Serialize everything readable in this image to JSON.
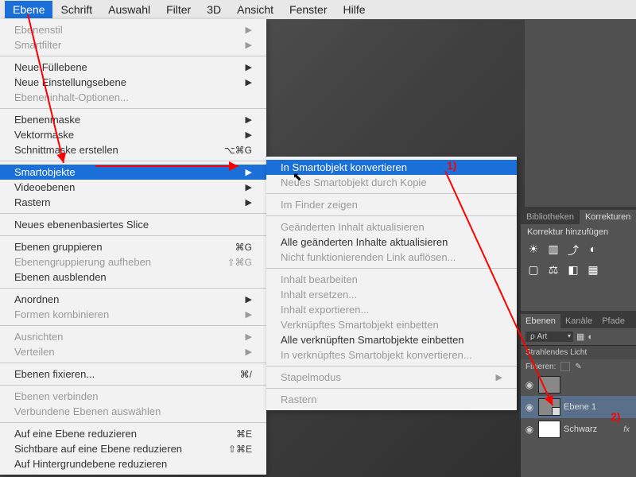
{
  "menubar": {
    "items": [
      "Ebene",
      "Schrift",
      "Auswahl",
      "Filter",
      "3D",
      "Ansicht",
      "Fenster",
      "Hilfe"
    ],
    "active": "Ebene"
  },
  "dropdown": {
    "items": [
      {
        "label": "Ebenenstil",
        "disabled": true,
        "submenu": true
      },
      {
        "label": "Smartfilter",
        "disabled": true,
        "submenu": true
      },
      {
        "sep": true
      },
      {
        "label": "Neue Füllebene",
        "submenu": true
      },
      {
        "label": "Neue Einstellungsebene",
        "submenu": true
      },
      {
        "label": "Ebeneninhalt-Optionen...",
        "disabled": true
      },
      {
        "sep": true
      },
      {
        "label": "Ebenenmaske",
        "submenu": true
      },
      {
        "label": "Vektormaske",
        "submenu": true
      },
      {
        "label": "Schnittmaske erstellen",
        "shortcut": "⌥⌘G"
      },
      {
        "sep": true
      },
      {
        "label": "Smartobjekte",
        "submenu": true,
        "highlight": true
      },
      {
        "label": "Videoebenen",
        "submenu": true
      },
      {
        "label": "Rastern",
        "submenu": true
      },
      {
        "sep": true
      },
      {
        "label": "Neues ebenenbasiertes Slice"
      },
      {
        "sep": true
      },
      {
        "label": "Ebenen gruppieren",
        "shortcut": "⌘G"
      },
      {
        "label": "Ebenengruppierung aufheben",
        "shortcut": "⇧⌘G",
        "disabled": true
      },
      {
        "label": "Ebenen ausblenden"
      },
      {
        "sep": true
      },
      {
        "label": "Anordnen",
        "submenu": true
      },
      {
        "label": "Formen kombinieren",
        "submenu": true,
        "disabled": true
      },
      {
        "sep": true
      },
      {
        "label": "Ausrichten",
        "submenu": true,
        "disabled": true
      },
      {
        "label": "Verteilen",
        "submenu": true,
        "disabled": true
      },
      {
        "sep": true
      },
      {
        "label": "Ebenen fixieren...",
        "shortcut": "⌘/"
      },
      {
        "sep": true
      },
      {
        "label": "Ebenen verbinden",
        "disabled": true
      },
      {
        "label": "Verbundene Ebenen auswählen",
        "disabled": true
      },
      {
        "sep": true
      },
      {
        "label": "Auf eine Ebene reduzieren",
        "shortcut": "⌘E"
      },
      {
        "label": "Sichtbare auf eine Ebene reduzieren",
        "shortcut": "⇧⌘E"
      },
      {
        "label": "Auf Hintergrundebene reduzieren"
      }
    ]
  },
  "submenu": {
    "items": [
      {
        "label": "In Smartobjekt konvertieren",
        "highlight": true
      },
      {
        "label": "Neues Smartobjekt durch Kopie",
        "disabled": true
      },
      {
        "sep": true
      },
      {
        "label": "Im Finder zeigen",
        "disabled": true
      },
      {
        "sep": true
      },
      {
        "label": "Geänderten Inhalt aktualisieren",
        "disabled": true
      },
      {
        "label": "Alle geänderten Inhalte aktualisieren"
      },
      {
        "label": "Nicht funktionierenden Link auflösen...",
        "disabled": true
      },
      {
        "sep": true
      },
      {
        "label": "Inhalt bearbeiten",
        "disabled": true
      },
      {
        "label": "Inhalt ersetzen...",
        "disabled": true
      },
      {
        "label": "Inhalt exportieren...",
        "disabled": true
      },
      {
        "label": "Verknüpftes Smartobjekt einbetten",
        "disabled": true
      },
      {
        "label": "Alle verknüpften Smartobjekte einbetten"
      },
      {
        "label": "In verknüpftes Smartobjekt konvertieren...",
        "disabled": true
      },
      {
        "sep": true
      },
      {
        "label": "Stapelmodus",
        "submenu": true,
        "disabled": true
      },
      {
        "sep": true
      },
      {
        "label": "Rastern",
        "disabled": true
      }
    ]
  },
  "panels": {
    "lib_tabs": [
      "Bibliotheken",
      "Korrekturen"
    ],
    "korrektur_label": "Korrektur hinzufügen",
    "layers_tabs": [
      "Ebenen",
      "Kanäle",
      "Pfade"
    ],
    "kind_label": "ρ Art",
    "group_name": "Strahlendes Licht",
    "fixieren_label": "Fixieren:",
    "layer1_name": "Ebene 1",
    "layer2_name": "Schwarz"
  },
  "annotations": {
    "a1": "1)",
    "a2": "2)"
  }
}
